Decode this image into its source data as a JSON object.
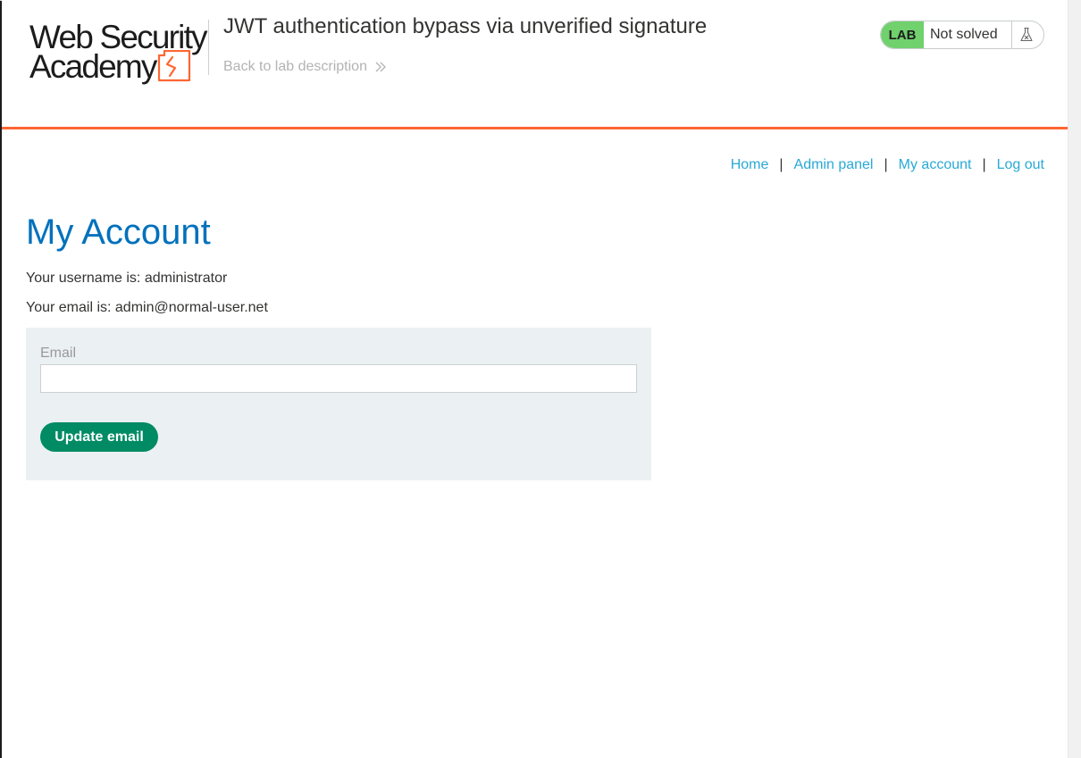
{
  "header": {
    "logo": {
      "line1": "Web Security",
      "line2": "Academy",
      "mark_icon": "academy-logo-mark-icon"
    },
    "lab_title": "JWT authentication bypass via unverified signature",
    "back_link": {
      "label": "Back to lab description",
      "icon": "double-chevron-right-icon"
    },
    "lab_status": {
      "badge": "LAB",
      "status": "Not solved",
      "icon": "flask-icon"
    }
  },
  "nav": {
    "items": [
      {
        "label": "Home"
      },
      {
        "label": "Admin panel"
      },
      {
        "label": "My account"
      },
      {
        "label": "Log out"
      }
    ],
    "separator": "|"
  },
  "main": {
    "title": "My Account",
    "username_line": "Your username is: administrator",
    "email_line": "Your email is: admin@normal-user.net",
    "form": {
      "email_label": "Email",
      "email_value": "",
      "submit_label": "Update email"
    }
  },
  "colors": {
    "accent_orange": "#ff6633",
    "title_blue": "#0071bc",
    "link_blue": "#29a9d6",
    "button_green": "#008b64",
    "lab_badge_green": "#70d16d",
    "panel_background": "#ebf0f2"
  }
}
